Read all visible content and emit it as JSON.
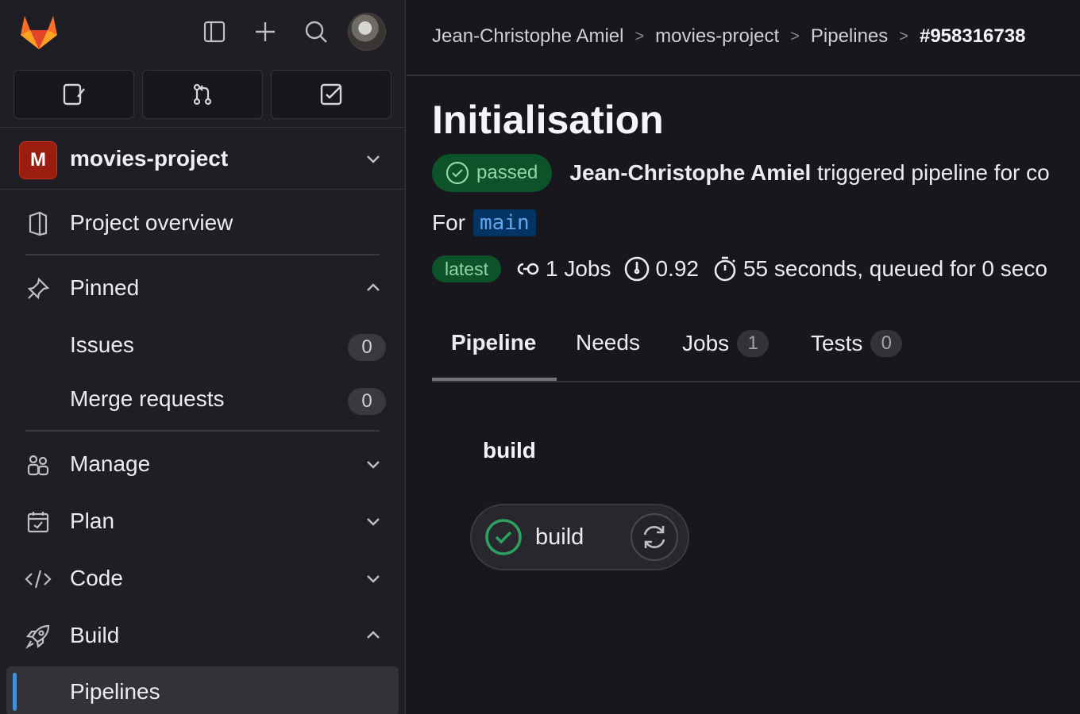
{
  "sidebar": {
    "project": {
      "initial": "M",
      "name": "movies-project"
    },
    "items": [
      {
        "label": "Project overview"
      },
      {
        "label": "Pinned"
      },
      {
        "label": "Issues",
        "count": "0"
      },
      {
        "label": "Merge requests",
        "count": "0"
      },
      {
        "label": "Manage"
      },
      {
        "label": "Plan"
      },
      {
        "label": "Code"
      },
      {
        "label": "Build"
      },
      {
        "label": "Pipelines"
      }
    ]
  },
  "breadcrumb": [
    "Jean-Christophe Amiel",
    "movies-project",
    "Pipelines",
    "#958316738"
  ],
  "pipeline": {
    "title": "Initialisation",
    "status": "passed",
    "author": "Jean-Christophe Amiel",
    "trigger_text": " triggered pipeline for co",
    "for_label": "For",
    "branch": "main",
    "latest_label": "latest",
    "jobs_text": "1 Jobs",
    "coverage": "0.92",
    "duration_text": "55 seconds, queued for 0 seco"
  },
  "tabs": [
    {
      "label": "Pipeline"
    },
    {
      "label": "Needs"
    },
    {
      "label": "Jobs",
      "count": "1"
    },
    {
      "label": "Tests",
      "count": "0"
    }
  ],
  "stage": {
    "title": "build",
    "job": {
      "name": "build",
      "status": "success"
    }
  },
  "colors": {
    "accent": "#428fdc",
    "success": "#2da160",
    "project_avatar": "#9b1d10"
  }
}
